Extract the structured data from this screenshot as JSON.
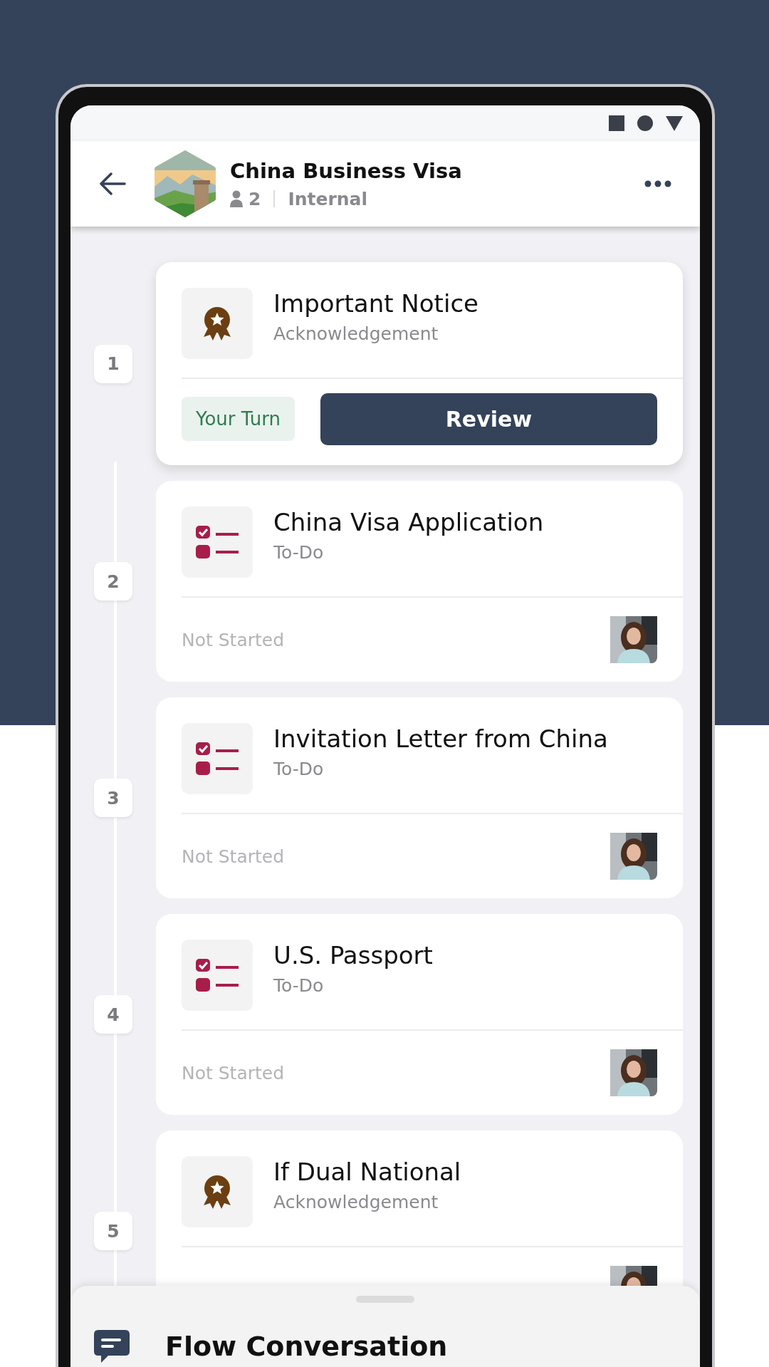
{
  "header": {
    "title": "China Business Visa",
    "member_count": "2",
    "visibility": "Internal"
  },
  "steps": [
    {
      "number": "1",
      "title": "Important Notice",
      "type": "Acknowledgement",
      "kind": "acknowledgement",
      "selected": true,
      "turn": "Your Turn",
      "action": "Review"
    },
    {
      "number": "2",
      "title": "China Visa Application",
      "type": "To-Do",
      "kind": "todo",
      "selected": false,
      "status": "Not Started"
    },
    {
      "number": "3",
      "title": "Invitation Letter from China",
      "type": "To-Do",
      "kind": "todo",
      "selected": false,
      "status": "Not Started"
    },
    {
      "number": "4",
      "title": "U.S. Passport",
      "type": "To-Do",
      "kind": "todo",
      "selected": false,
      "status": "Not Started"
    },
    {
      "number": "5",
      "title": "If Dual National",
      "type": "Acknowledgement",
      "kind": "acknowledgement",
      "selected": false
    }
  ],
  "bottom_sheet": {
    "title": "Flow Conversation"
  }
}
